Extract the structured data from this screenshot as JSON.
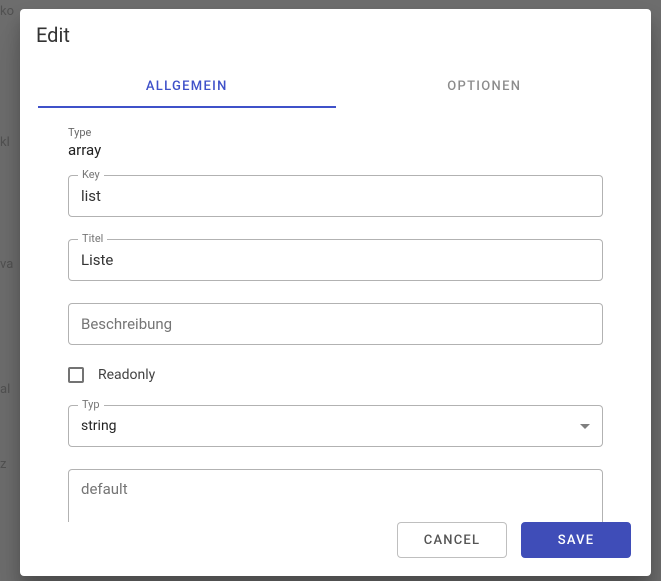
{
  "dialog": {
    "title": "Edit",
    "tabs": {
      "general": "Allgemein",
      "options": "Optionen"
    }
  },
  "form": {
    "type_label": "Type",
    "type_value": "array",
    "key_label": "Key",
    "key_value": "list",
    "title_label": "Titel",
    "title_value": "Liste",
    "description_placeholder": "Beschreibung",
    "description_value": "",
    "readonly_label": "Readonly",
    "readonly_checked": false,
    "item_type_label": "Typ",
    "item_type_value": "string",
    "default_placeholder": "default",
    "default_value": ""
  },
  "actions": {
    "cancel": "Cancel",
    "save": "Save"
  }
}
